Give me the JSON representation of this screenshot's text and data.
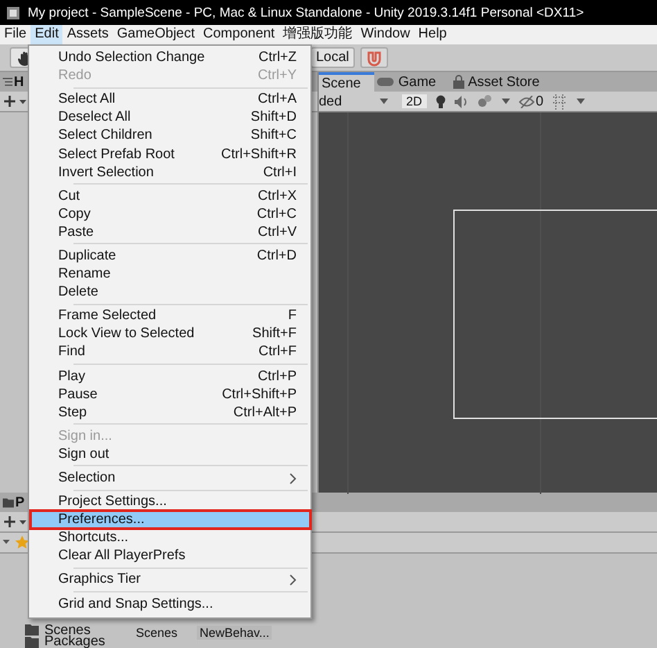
{
  "window": {
    "title": "My project - SampleScene - PC, Mac & Linux Standalone - Unity 2019.3.14f1 Personal <DX11>"
  },
  "menu_bar": [
    {
      "label": "File",
      "selected": false
    },
    {
      "label": "Edit",
      "selected": true
    },
    {
      "label": "Assets",
      "selected": false
    },
    {
      "label": "GameObject",
      "selected": false
    },
    {
      "label": "Component",
      "selected": false
    },
    {
      "label": "增强版功能",
      "selected": false
    },
    {
      "label": "Window",
      "selected": false
    },
    {
      "label": "Help",
      "selected": false
    }
  ],
  "toolbar": {
    "pivot_button": "Local"
  },
  "hierarchy": {
    "tab": "H"
  },
  "scene_tabs": [
    {
      "label": "Scene",
      "selected": true,
      "kind": "scene"
    },
    {
      "label": "Game",
      "selected": false,
      "kind": "game"
    },
    {
      "label": "Asset Store",
      "selected": false,
      "kind": "store"
    }
  ],
  "scene_toolbar": {
    "draw_mode": "ded",
    "mode_button": "2D",
    "hidden_count": "0"
  },
  "project": {
    "tab": "P",
    "tree": [
      {
        "label": "Scenes"
      },
      {
        "label": "Packages"
      }
    ],
    "breadcrumb": "Scenes",
    "files": [
      "NewBehav..."
    ]
  },
  "edit_menu": {
    "sections": [
      [
        {
          "label": "Undo Selection Change",
          "shortcut": "Ctrl+Z",
          "disabled": false,
          "submenu": false,
          "selected": false,
          "marked": false
        },
        {
          "label": "Redo",
          "shortcut": "Ctrl+Y",
          "disabled": true,
          "submenu": false,
          "selected": false,
          "marked": false
        }
      ],
      [
        {
          "label": "Select All",
          "shortcut": "Ctrl+A",
          "disabled": false,
          "submenu": false,
          "selected": false,
          "marked": false
        },
        {
          "label": "Deselect All",
          "shortcut": "Shift+D",
          "disabled": false,
          "submenu": false,
          "selected": false,
          "marked": false
        },
        {
          "label": "Select Children",
          "shortcut": "Shift+C",
          "disabled": false,
          "submenu": false,
          "selected": false,
          "marked": false
        },
        {
          "label": "Select Prefab Root",
          "shortcut": "Ctrl+Shift+R",
          "disabled": false,
          "submenu": false,
          "selected": false,
          "marked": false
        },
        {
          "label": "Invert Selection",
          "shortcut": "Ctrl+I",
          "disabled": false,
          "submenu": false,
          "selected": false,
          "marked": false
        }
      ],
      [
        {
          "label": "Cut",
          "shortcut": "Ctrl+X",
          "disabled": false,
          "submenu": false,
          "selected": false,
          "marked": false
        },
        {
          "label": "Copy",
          "shortcut": "Ctrl+C",
          "disabled": false,
          "submenu": false,
          "selected": false,
          "marked": false
        },
        {
          "label": "Paste",
          "shortcut": "Ctrl+V",
          "disabled": false,
          "submenu": false,
          "selected": false,
          "marked": false
        }
      ],
      [
        {
          "label": "Duplicate",
          "shortcut": "Ctrl+D",
          "disabled": false,
          "submenu": false,
          "selected": false,
          "marked": false
        },
        {
          "label": "Rename",
          "disabled": false,
          "submenu": false,
          "selected": false,
          "marked": false
        },
        {
          "label": "Delete",
          "disabled": false,
          "submenu": false,
          "selected": false,
          "marked": false
        }
      ],
      [
        {
          "label": "Frame Selected",
          "shortcut": "F",
          "disabled": false,
          "submenu": false,
          "selected": false,
          "marked": false
        },
        {
          "label": "Lock View to Selected",
          "shortcut": "Shift+F",
          "disabled": false,
          "submenu": false,
          "selected": false,
          "marked": false
        },
        {
          "label": "Find",
          "shortcut": "Ctrl+F",
          "disabled": false,
          "submenu": false,
          "selected": false,
          "marked": false
        }
      ],
      [
        {
          "label": "Play",
          "shortcut": "Ctrl+P",
          "disabled": false,
          "submenu": false,
          "selected": false,
          "marked": false
        },
        {
          "label": "Pause",
          "shortcut": "Ctrl+Shift+P",
          "disabled": false,
          "submenu": false,
          "selected": false,
          "marked": false
        },
        {
          "label": "Step",
          "shortcut": "Ctrl+Alt+P",
          "disabled": false,
          "submenu": false,
          "selected": false,
          "marked": false
        }
      ],
      [
        {
          "label": "Sign in...",
          "disabled": true,
          "submenu": false,
          "selected": false,
          "marked": false
        },
        {
          "label": "Sign out",
          "disabled": false,
          "submenu": false,
          "selected": false,
          "marked": false
        }
      ],
      [
        {
          "label": "Selection",
          "disabled": false,
          "submenu": true,
          "selected": false,
          "marked": false
        }
      ],
      [
        {
          "label": "Project Settings...",
          "disabled": false,
          "submenu": false,
          "selected": false,
          "marked": false
        },
        {
          "label": "Preferences...",
          "disabled": false,
          "submenu": false,
          "selected": true,
          "marked": true
        },
        {
          "label": "Shortcuts...",
          "disabled": false,
          "submenu": false,
          "selected": false,
          "marked": false
        },
        {
          "label": "Clear All PlayerPrefs",
          "disabled": false,
          "submenu": false,
          "selected": false,
          "marked": false
        }
      ],
      [
        {
          "label": "Graphics Tier",
          "disabled": false,
          "submenu": true,
          "selected": false,
          "marked": false
        }
      ],
      [
        {
          "label": "Grid and Snap Settings...",
          "disabled": false,
          "submenu": false,
          "selected": false,
          "marked": false
        }
      ]
    ]
  }
}
